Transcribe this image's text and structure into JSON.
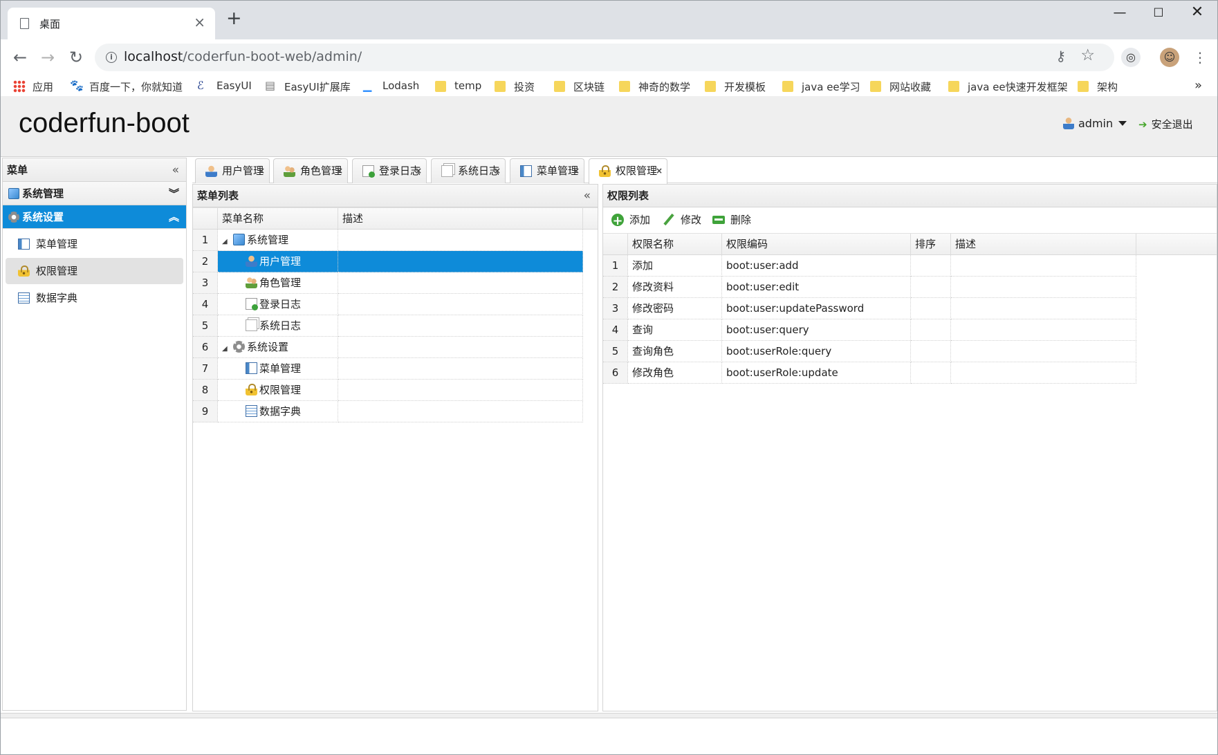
{
  "browser": {
    "tab_title": "桌面",
    "url_host": "localhost",
    "url_path": "/coderfun-boot-web/admin/",
    "bookmarks": [
      {
        "label": "应用",
        "icon": "apps-icon"
      },
      {
        "label": "百度一下，你就知道",
        "icon": "baidu-icon"
      },
      {
        "label": "EasyUI",
        "icon": "easyui-icon"
      },
      {
        "label": "EasyUI扩展库",
        "icon": "page-icon"
      },
      {
        "label": "Lodash",
        "icon": "lodash-icon"
      },
      {
        "label": "temp",
        "icon": "folder-icon"
      },
      {
        "label": "投资",
        "icon": "folder-icon"
      },
      {
        "label": "区块链",
        "icon": "folder-icon"
      },
      {
        "label": "神奇的数学",
        "icon": "folder-icon"
      },
      {
        "label": "开发模板",
        "icon": "folder-icon"
      },
      {
        "label": "java ee学习",
        "icon": "folder-icon"
      },
      {
        "label": "网站收藏",
        "icon": "folder-icon"
      },
      {
        "label": "java ee快速开发框架",
        "icon": "folder-icon"
      },
      {
        "label": "架构",
        "icon": "folder-icon"
      }
    ]
  },
  "header": {
    "brand": "coderfun-boot",
    "user": "admin",
    "logout": "安全退出"
  },
  "west": {
    "title": "菜单",
    "accordions": [
      {
        "label": "系统管理",
        "selected": false
      },
      {
        "label": "系统设置",
        "selected": true
      }
    ],
    "items": [
      "菜单管理",
      "权限管理",
      "数据字典"
    ]
  },
  "tabs": [
    "用户管理",
    "角色管理",
    "登录日志",
    "系统日志",
    "菜单管理",
    "权限管理"
  ],
  "menu_panel": {
    "title": "菜单列表",
    "columns": [
      "菜单名称",
      "描述"
    ],
    "rows": [
      {
        "n": "1",
        "name": "系统管理",
        "desc": ""
      },
      {
        "n": "2",
        "name": "用户管理",
        "desc": ""
      },
      {
        "n": "3",
        "name": "角色管理",
        "desc": ""
      },
      {
        "n": "4",
        "name": "登录日志",
        "desc": ""
      },
      {
        "n": "5",
        "name": "系统日志",
        "desc": ""
      },
      {
        "n": "6",
        "name": "系统设置",
        "desc": ""
      },
      {
        "n": "7",
        "name": "菜单管理",
        "desc": ""
      },
      {
        "n": "8",
        "name": "权限管理",
        "desc": ""
      },
      {
        "n": "9",
        "name": "数据字典",
        "desc": ""
      }
    ]
  },
  "perm_panel": {
    "title": "权限列表",
    "buttons": {
      "add": "添加",
      "edit": "修改",
      "delete": "删除"
    },
    "columns": [
      "权限名称",
      "权限编码",
      "排序",
      "描述"
    ],
    "rows": [
      {
        "n": "1",
        "name": "添加",
        "code": "boot:user:add",
        "sort": "",
        "desc": ""
      },
      {
        "n": "2",
        "name": "修改资料",
        "code": "boot:user:edit",
        "sort": "",
        "desc": ""
      },
      {
        "n": "3",
        "name": "修改密码",
        "code": "boot:user:updatePassword",
        "sort": "",
        "desc": ""
      },
      {
        "n": "4",
        "name": "查询",
        "code": "boot:user:query",
        "sort": "",
        "desc": ""
      },
      {
        "n": "5",
        "name": "查询角色",
        "code": "boot:userRole:query",
        "sort": "",
        "desc": ""
      },
      {
        "n": "6",
        "name": "修改角色",
        "code": "boot:userRole:update",
        "sort": "",
        "desc": ""
      }
    ]
  }
}
